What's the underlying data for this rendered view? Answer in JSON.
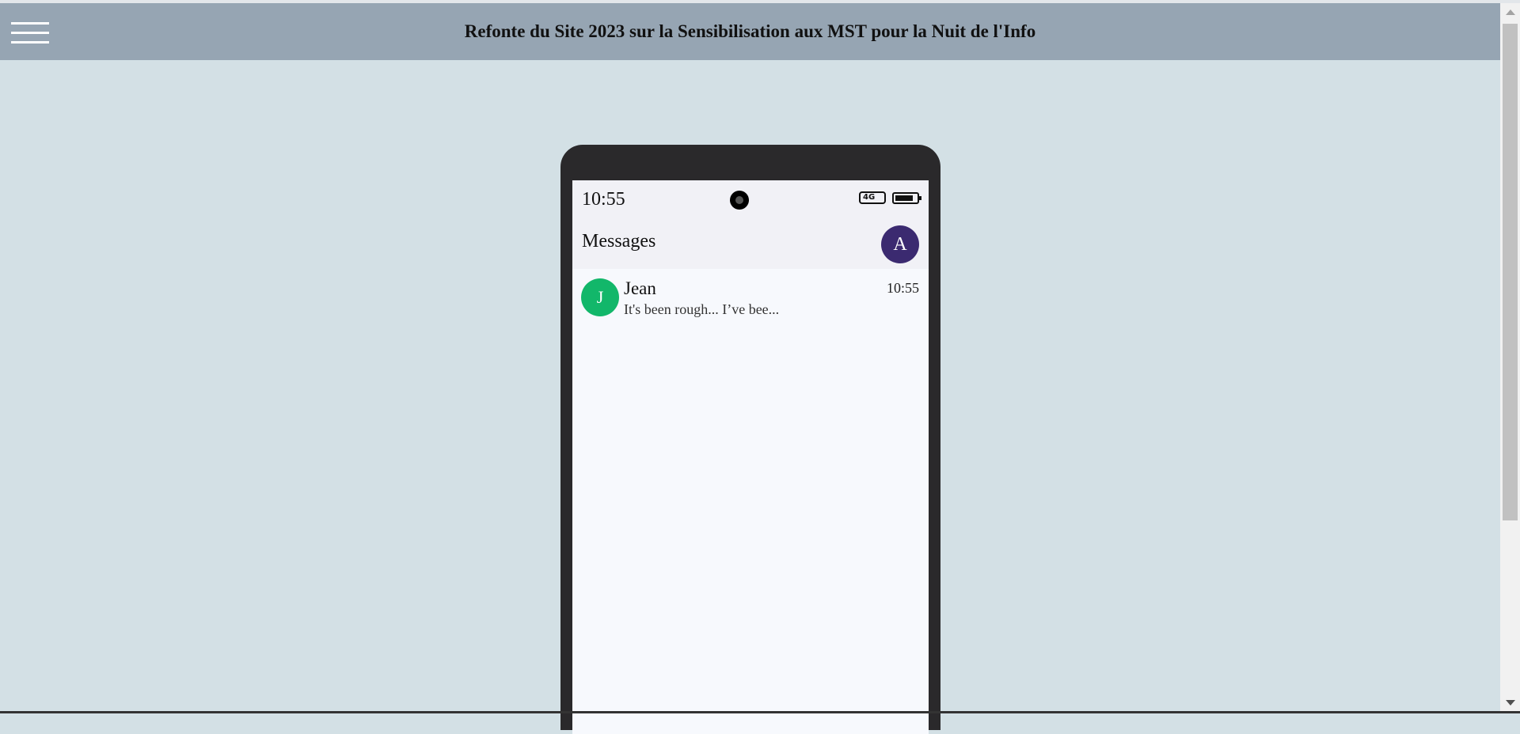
{
  "header": {
    "title": "Refonte du Site 2023 sur la Sensibilisation aux MST pour la Nuit de l'Info",
    "menu_icon": "hamburger-menu-icon"
  },
  "phone": {
    "status_bar": {
      "time": "10:55",
      "network_label": "4G",
      "icons": [
        "front-camera-icon",
        "network-4g-icon",
        "battery-icon"
      ]
    },
    "app_bar": {
      "title": "Messages",
      "profile_initial": "A"
    },
    "conversations": [
      {
        "initial": "J",
        "name": "Jean",
        "preview": "It's been rough... I’ve bee...",
        "time": "10:55"
      }
    ]
  },
  "colors": {
    "page_background": "#d3e0e5",
    "header_background": "#96a5b3",
    "phone_body": "#2a292b",
    "profile_avatar": "#3b2a70",
    "contact_avatar": "#12b76a"
  }
}
